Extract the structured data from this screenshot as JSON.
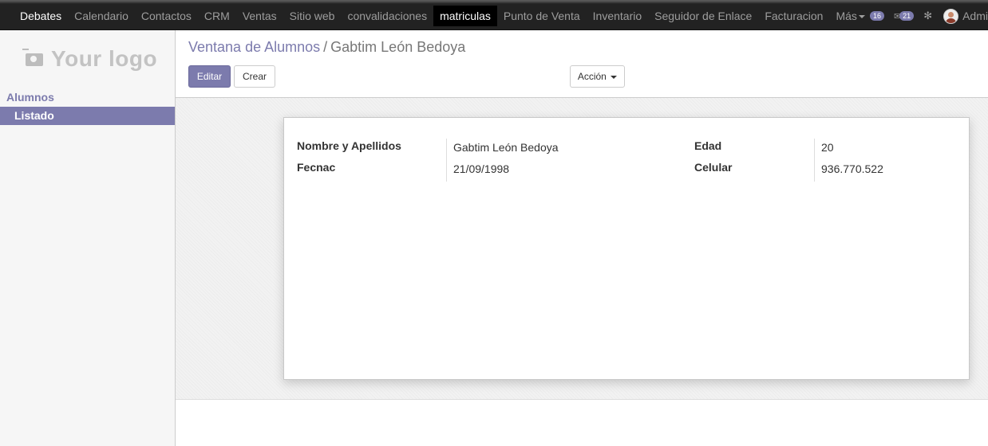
{
  "topnav": {
    "items": [
      "Debates",
      "Calendario",
      "Contactos",
      "CRM",
      "Ventas",
      "Sitio web",
      "convalidaciones",
      "matriculas",
      "Punto de Venta",
      "Inventario",
      "Seguidor de Enlace",
      "Facturacion",
      "Más"
    ],
    "active": "matriculas",
    "messages_count": "16",
    "chat_count": "21",
    "user_label": "Admi"
  },
  "sidebar": {
    "logo_text": "Your logo",
    "section": "Alumnos",
    "items": [
      {
        "label": "Listado",
        "active": true
      }
    ]
  },
  "breadcrumb": {
    "parent": "Ventana de Alumnos",
    "separator": "/",
    "current": "Gabtim León Bedoya"
  },
  "buttons": {
    "edit": "Editar",
    "create": "Crear",
    "action": "Acción"
  },
  "form": {
    "fields": [
      {
        "label": "Nombre y Apellidos",
        "value": "Gabtim León Bedoya"
      },
      {
        "label": "Fecnac",
        "value": "21/09/1998"
      },
      {
        "label": "Edad",
        "value": "20"
      },
      {
        "label": "Celular",
        "value": "936.770.522"
      }
    ]
  },
  "colors": {
    "brand": "#7c7bad",
    "navbar": "#222222"
  }
}
